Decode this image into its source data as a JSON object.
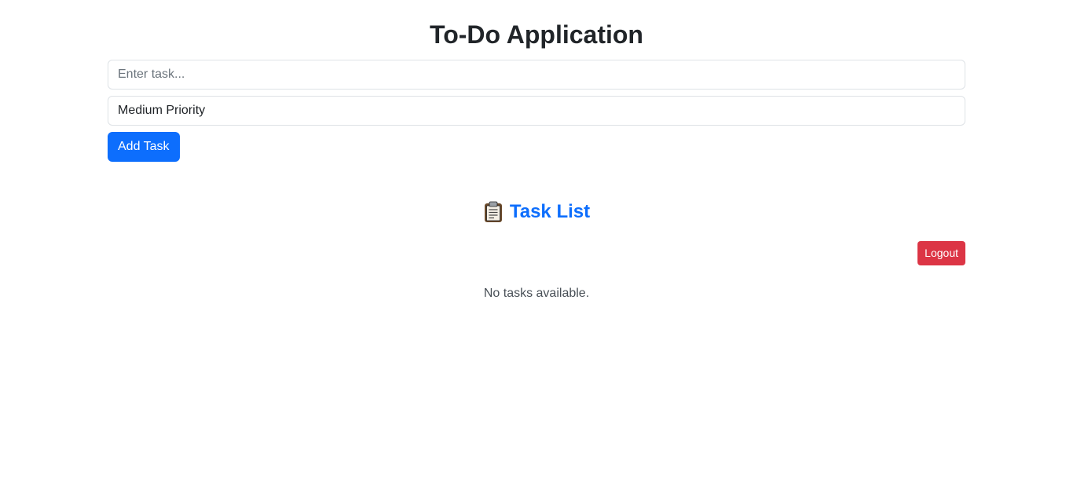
{
  "app": {
    "title": "To-Do Application"
  },
  "form": {
    "task_placeholder": "Enter task...",
    "task_value": "",
    "priority_selected": "Medium Priority",
    "add_button_label": "Add Task"
  },
  "task_list": {
    "heading_icon": "clipboard-icon",
    "heading": "Task List",
    "logout_label": "Logout",
    "empty_message": "No tasks available."
  },
  "colors": {
    "primary": "#0d6efd",
    "danger": "#dc3545",
    "text": "#212529"
  }
}
